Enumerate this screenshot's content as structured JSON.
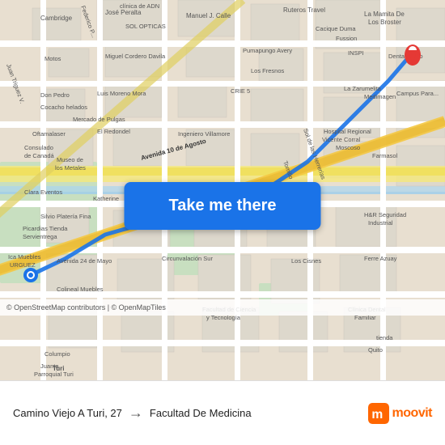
{
  "map": {
    "bg_color": "#e8dfd0",
    "start_location": "Camino Viejo A Turi, 27",
    "end_location": "Facultad De Medicina",
    "button_label": "Take me there",
    "copyright": "© OpenStreetMap contributors | © OpenMapTiles",
    "arrow": "→"
  },
  "moovit": {
    "logo_text": "moovit"
  },
  "roads": {
    "main_diagonal_color": "#f5c842",
    "route_color": "#1a73e8"
  }
}
